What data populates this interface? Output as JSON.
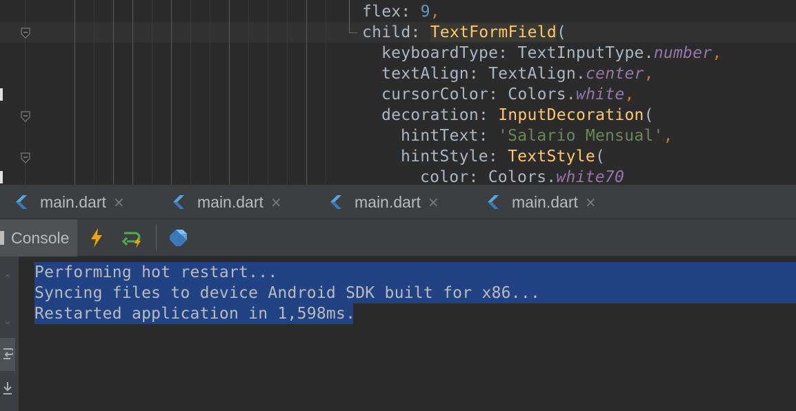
{
  "editor": {
    "lines": [
      {
        "indent": "",
        "parts": [
          {
            "t": "flex",
            "c": ""
          },
          {
            "t": ": ",
            "c": ""
          },
          {
            "t": "9",
            "c": "num"
          },
          {
            "t": ",",
            "c": "punct"
          }
        ]
      },
      {
        "indent": "",
        "parts": [
          {
            "t": "child",
            "c": ""
          },
          {
            "t": ": ",
            "c": ""
          },
          {
            "t": "TextFormField",
            "c": "cls hl"
          },
          {
            "t": "(",
            "c": ""
          }
        ]
      },
      {
        "indent": "  ",
        "parts": [
          {
            "t": "keyboardType",
            "c": ""
          },
          {
            "t": ": ",
            "c": ""
          },
          {
            "t": "TextInputType.",
            "c": ""
          },
          {
            "t": "number",
            "c": "italic"
          },
          {
            "t": ",",
            "c": "punct"
          }
        ]
      },
      {
        "indent": "  ",
        "parts": [
          {
            "t": "textAlign",
            "c": ""
          },
          {
            "t": ": ",
            "c": ""
          },
          {
            "t": "TextAlign.",
            "c": ""
          },
          {
            "t": "center",
            "c": "italic"
          },
          {
            "t": ",",
            "c": "punct"
          }
        ]
      },
      {
        "indent": "  ",
        "parts": [
          {
            "t": "cursorColor",
            "c": ""
          },
          {
            "t": ": ",
            "c": ""
          },
          {
            "t": "Colors.",
            "c": ""
          },
          {
            "t": "white",
            "c": "italic"
          },
          {
            "t": ",",
            "c": "punct"
          }
        ]
      },
      {
        "indent": "  ",
        "parts": [
          {
            "t": "decoration",
            "c": ""
          },
          {
            "t": ": ",
            "c": ""
          },
          {
            "t": "InputDecoration",
            "c": "cls"
          },
          {
            "t": "(",
            "c": ""
          }
        ]
      },
      {
        "indent": "    ",
        "parts": [
          {
            "t": "hintText",
            "c": ""
          },
          {
            "t": ": ",
            "c": ""
          },
          {
            "t": "'Salario Mensual'",
            "c": "str"
          },
          {
            "t": ",",
            "c": "punct"
          }
        ]
      },
      {
        "indent": "    ",
        "parts": [
          {
            "t": "hintStyle",
            "c": ""
          },
          {
            "t": ": ",
            "c": ""
          },
          {
            "t": "TextStyle",
            "c": "cls"
          },
          {
            "t": "(",
            "c": ""
          }
        ]
      },
      {
        "indent": "      ",
        "parts": [
          {
            "t": "color",
            "c": ""
          },
          {
            "t": ": ",
            "c": ""
          },
          {
            "t": "Colors.",
            "c": ""
          },
          {
            "t": "white70",
            "c": "italic"
          }
        ]
      }
    ]
  },
  "tabs": [
    {
      "label": "main.dart",
      "icon": "dart-file-icon"
    },
    {
      "label": "main.dart",
      "icon": "dart-file-icon"
    },
    {
      "label": "main.dart",
      "icon": "dart-file-icon"
    },
    {
      "label": "main.dart",
      "icon": "dart-file-icon"
    }
  ],
  "tab_close_glyph": "×",
  "console": {
    "tab_label": "Console",
    "tools": [
      "hot-reload-icon",
      "hot-restart-icon",
      "dart-devtools-icon"
    ],
    "output": [
      "Performing hot restart...",
      "Syncing files to device Android SDK built for x86...",
      "Restarted application in 1,598ms."
    ]
  },
  "colors": {
    "background": "#2b2b2b",
    "panel": "#3c3f41",
    "selection": "#214283",
    "hot_reload": "#f0a30a",
    "hot_restart": "#4caf50",
    "dart_blue": "#4a8fc8"
  }
}
